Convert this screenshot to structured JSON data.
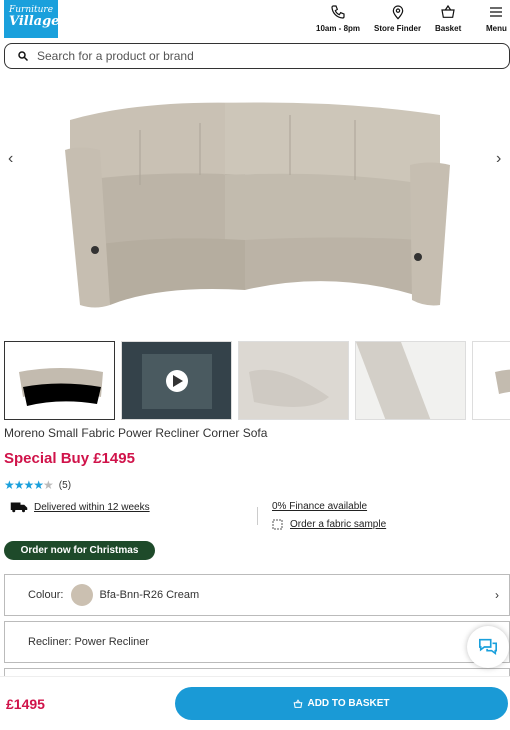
{
  "header": {
    "logo_line1": "Furniture",
    "logo_line2": "Village",
    "hours": "10am - 8pm",
    "store_finder": "Store Finder",
    "basket": "Basket",
    "menu": "Menu"
  },
  "search": {
    "placeholder": "Search for a product or brand"
  },
  "product": {
    "title": "Moreno Small Fabric Power Recliner Corner Sofa",
    "price": "Special Buy £1495",
    "rating_count": "(5)",
    "rating_value": 4,
    "delivery": "Delivered within 12 weeks",
    "finance": "0% Finance available",
    "sample": "Order a fabric sample",
    "badge": "Order now for Christmas"
  },
  "options": {
    "colour_label": "Colour:",
    "colour_value": "Bfa-Bnn-R26 Cream",
    "recliner": "Recliner: Power Recliner"
  },
  "bottom": {
    "price": "£1495",
    "button": "ADD TO BASKET"
  },
  "colors": {
    "brand": "#1aa0dc",
    "price": "#d0134a",
    "badge": "#1e4a2a"
  }
}
